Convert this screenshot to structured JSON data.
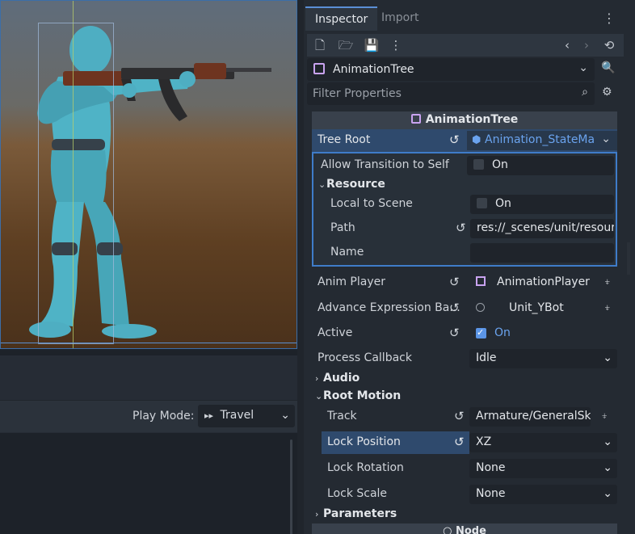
{
  "viewport": {
    "character_desc": "3D character model holding rifle"
  },
  "anim_panel": {
    "play_mode_label": "Play Mode:",
    "play_mode_value": "Travel",
    "play_mode_icon": "▸▸"
  },
  "inspector": {
    "tabs": [
      {
        "label": "Inspector",
        "active": true
      },
      {
        "label": "Import",
        "active": false
      }
    ],
    "object_name": "AnimationTree",
    "filter_placeholder": "Filter Properties",
    "section_title": "AnimationTree",
    "tree_root": {
      "label": "Tree Root",
      "value": "Animation_StateMa"
    },
    "sub": {
      "allow_transition": {
        "label": "Allow Transition to Self",
        "value": "On"
      },
      "resource_group": "Resource",
      "local_to_scene": {
        "label": "Local to Scene",
        "value": "On"
      },
      "path": {
        "label": "Path",
        "value": "res://_scenes/unit/resour"
      },
      "name": {
        "label": "Name",
        "value": ""
      }
    },
    "anim_player": {
      "label": "Anim Player",
      "value": "AnimationPlayer"
    },
    "advance_expr": {
      "label": "Advance Expression Ba...",
      "value": "Unit_YBot"
    },
    "active": {
      "label": "Active",
      "value": "On"
    },
    "process_callback": {
      "label": "Process Callback",
      "value": "Idle"
    },
    "audio_group": "Audio",
    "root_motion_group": "Root Motion",
    "track": {
      "label": "Track",
      "value": "Armature/GeneralSk"
    },
    "lock_position": {
      "label": "Lock Position",
      "value": "XZ"
    },
    "lock_rotation": {
      "label": "Lock Rotation",
      "value": "None"
    },
    "lock_scale": {
      "label": "Lock Scale",
      "value": "None"
    },
    "parameters_group": "Parameters",
    "node_section": "Node"
  },
  "colors": {
    "accent": "#5b8fd6",
    "selected_row": "#2f4a6d",
    "link_blue": "#6aa3ee",
    "resource_purple": "#c9a3f0"
  }
}
